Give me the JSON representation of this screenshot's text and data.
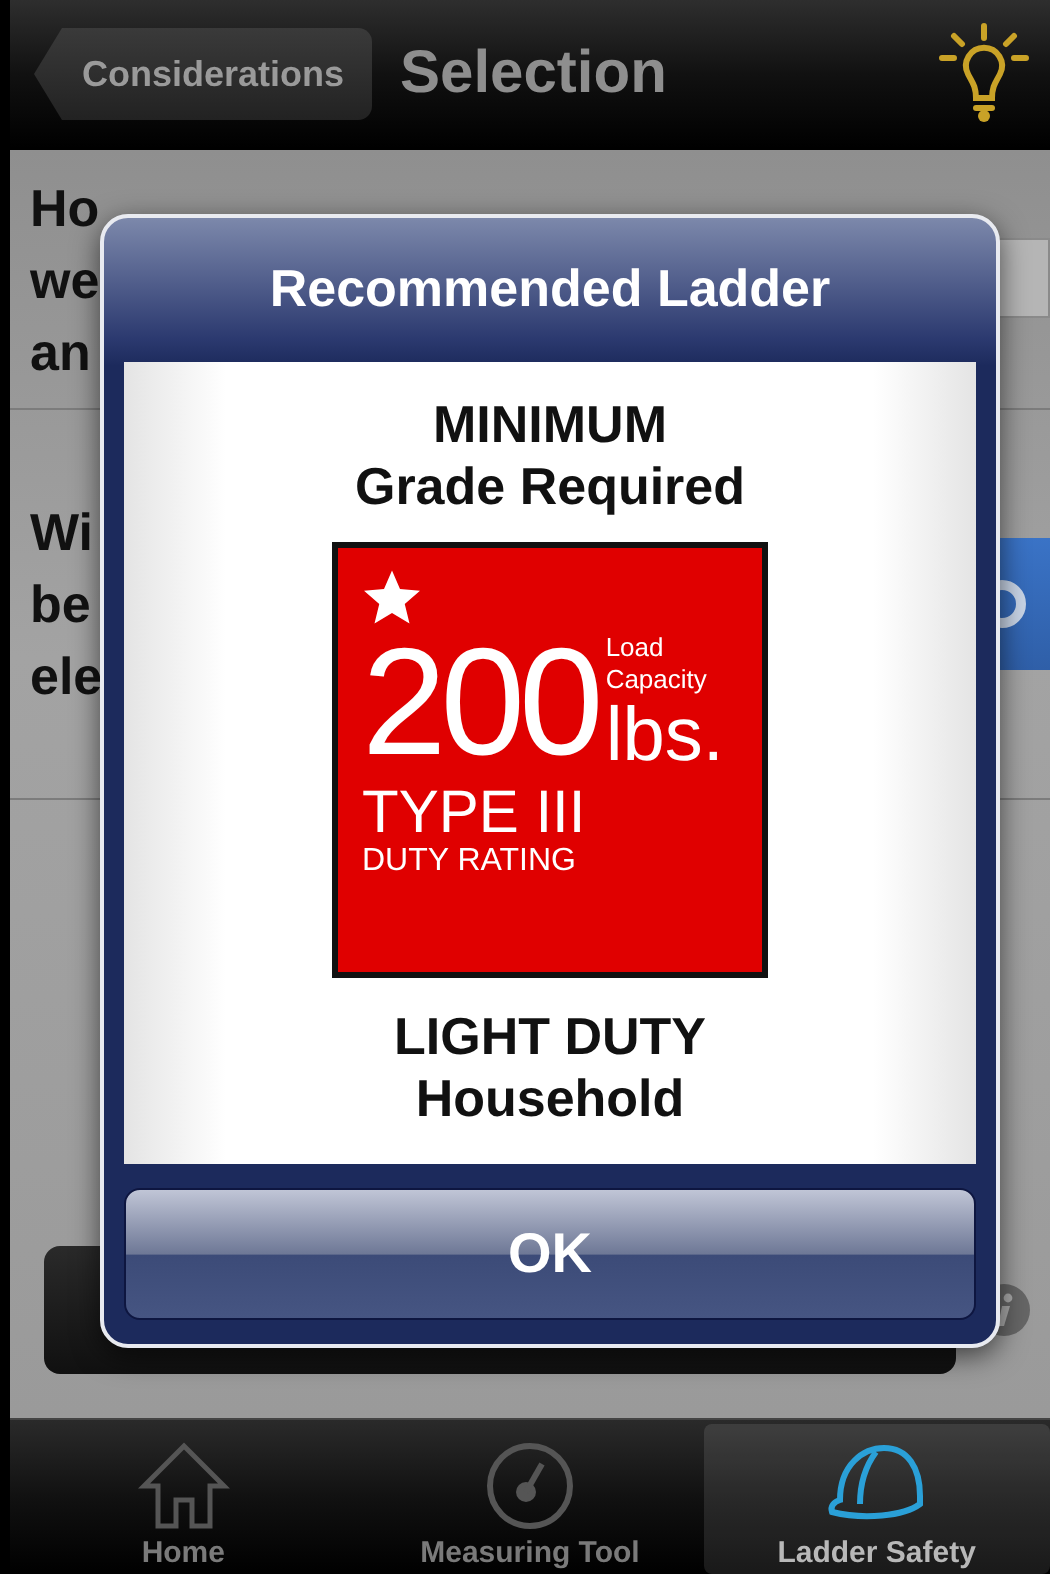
{
  "nav": {
    "back": "Considerations",
    "title": "Selection"
  },
  "questions": [
    {
      "kind": "field",
      "lines": [
        "Ho",
        "we",
        "an"
      ]
    },
    {
      "kind": "toggle",
      "lines": [
        "Wi",
        "be",
        "ele"
      ],
      "on": true
    }
  ],
  "dialog": {
    "title": "Recommended Ladder",
    "heading": [
      "MINIMUM",
      "Grade Required"
    ],
    "label": {
      "number": "200",
      "capacity": [
        "Load",
        "Capacity"
      ],
      "unit": "lbs.",
      "type": "TYPE III",
      "rating": "DUTY RATING"
    },
    "footer": [
      "LIGHT DUTY",
      "Household"
    ],
    "button": "OK"
  },
  "tabs": [
    {
      "kind": "home",
      "label": "Home",
      "selected": false
    },
    {
      "kind": "gauge",
      "label": "Measuring Tool",
      "selected": false
    },
    {
      "kind": "helmet",
      "label": "Ladder Safety",
      "selected": true
    }
  ]
}
